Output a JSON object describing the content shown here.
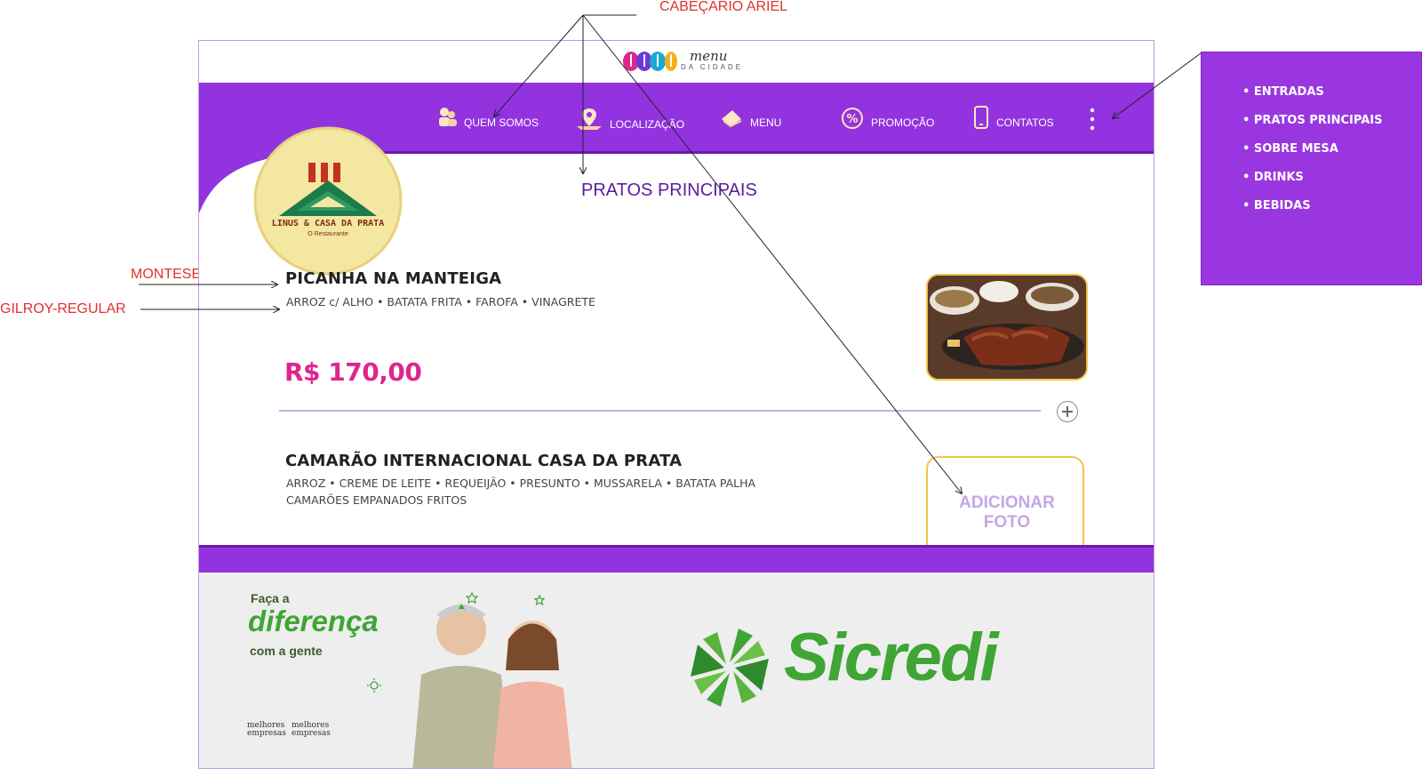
{
  "annotations": {
    "header_font": "CABEÇARIO ARIEL",
    "title_font": "MONTESERRAT",
    "desc_font": "GILROY-REGULAR"
  },
  "brand": {
    "logo_word": "menu",
    "logo_sub": "DA CIDADE",
    "restaurant_name": "LINUS & CASA DA PRATA",
    "restaurant_sub": "O Restaurante"
  },
  "nav": {
    "items": [
      {
        "label": "QUEM SOMOS",
        "icon": "people-icon"
      },
      {
        "label": "LOCALIZAÇÃO",
        "icon": "location-pin-icon"
      },
      {
        "label": "MENU",
        "icon": "menu-book-icon"
      },
      {
        "label": "PROMOÇÃO",
        "icon": "percent-icon"
      },
      {
        "label": "CONTATOS",
        "icon": "phone-icon"
      }
    ],
    "more_icon": "kebab-menu-icon"
  },
  "section_title": "PRATOS PRINCIPAIS",
  "dishes": [
    {
      "title": "PICANHA NA MANTEIGA",
      "description": "ARROZ c/ ALHO • BATATA FRITA • FAROFA • VINAGRETE",
      "price": "R$ 170,00",
      "has_photo": true
    },
    {
      "title": "CAMARÃO INTERNACIONAL CASA DA PRATA",
      "description_line1": "ARROZ • CREME DE LEITE • REQUEIJÃO • PRESUNTO • MUSSARELA • BATATA PALHA",
      "description_line2": "CAMARÕES EMPANADOS FRITOS",
      "add_photo_label": "ADICIONAR FOTO",
      "has_photo": false
    }
  ],
  "side_menu": {
    "items": [
      "ENTRADAS",
      "PRATOS PRINCIPAIS",
      "SOBRE MESA",
      "DRINKS",
      "BEBIDAS"
    ]
  },
  "ad": {
    "line1": "Faça a",
    "line2": "diferença",
    "line3": "com a gente",
    "brand": "Sicredi",
    "badge_text": "melhores empresas"
  },
  "colors": {
    "purple": "#9333e0",
    "purple_dark": "#6b1aa8",
    "price_pink": "#e0258d",
    "annotation_red": "#e0322b",
    "sicredi_green": "#3fa535"
  }
}
